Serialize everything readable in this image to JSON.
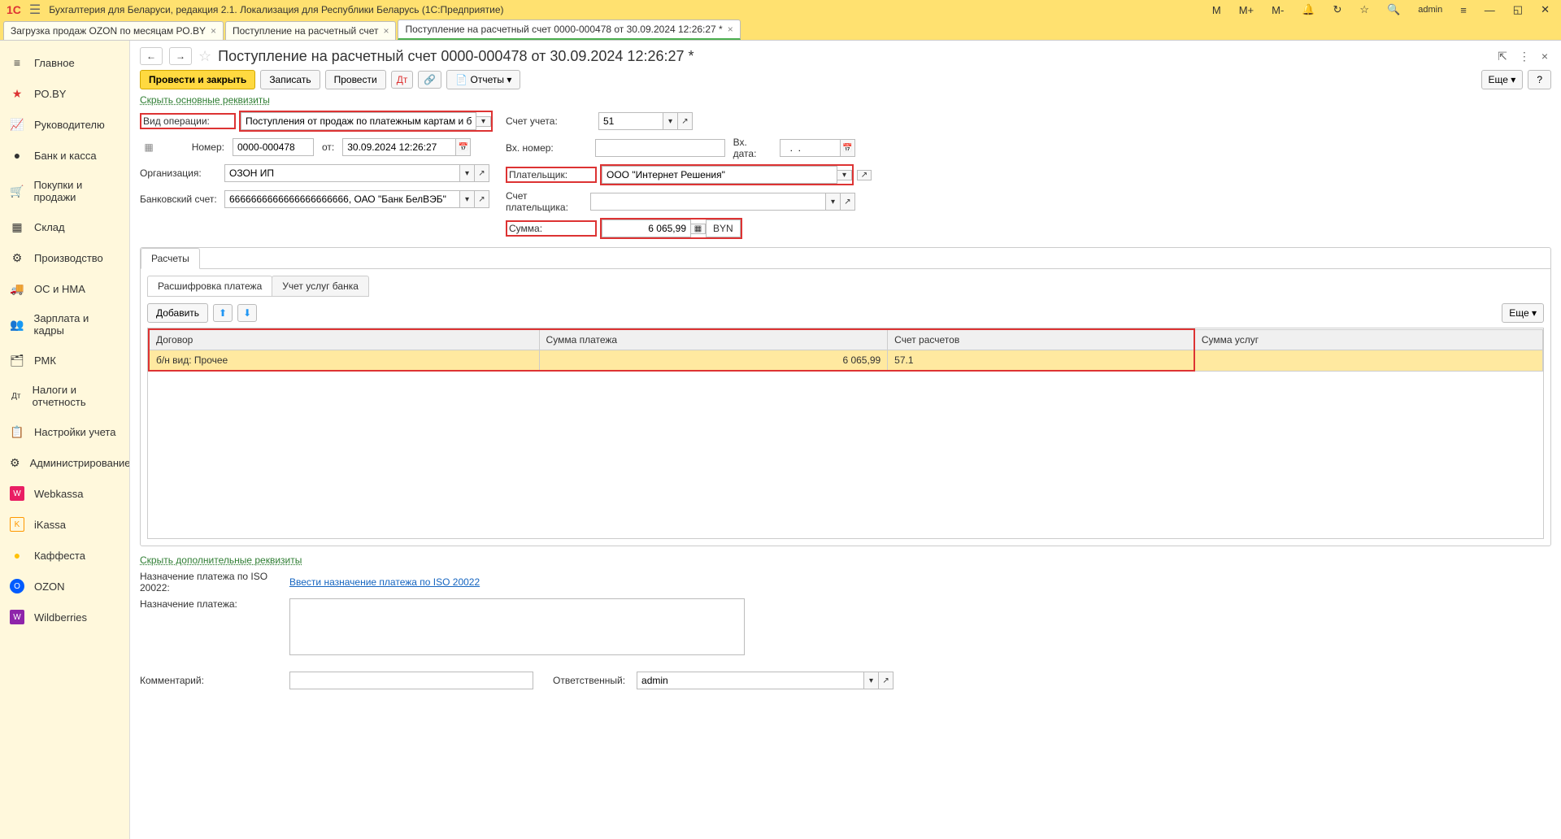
{
  "titlebar": {
    "app_title": "Бухгалтерия для Беларуси, редакция 2.1. Локализация для Республики Беларусь   (1С:Предприятие)",
    "user": "admin",
    "m": "M",
    "m_plus": "M+",
    "m_minus": "M-"
  },
  "doctabs": [
    {
      "label": "Загрузка продаж OZON по месяцам РО.BY",
      "active": false
    },
    {
      "label": "Поступление на расчетный счет",
      "active": false
    },
    {
      "label": "Поступление на расчетный счет 0000-000478 от 30.09.2024 12:26:27 *",
      "active": true
    }
  ],
  "sidebar": [
    {
      "label": "Главное",
      "icon": "≡"
    },
    {
      "label": "РО.BY",
      "icon": "★"
    },
    {
      "label": "Руководителю",
      "icon": "📈"
    },
    {
      "label": "Банк и касса",
      "icon": "💰"
    },
    {
      "label": "Покупки и продажи",
      "icon": "🛒"
    },
    {
      "label": "Склад",
      "icon": "▦"
    },
    {
      "label": "Производство",
      "icon": "🏭"
    },
    {
      "label": "ОС и НМА",
      "icon": "🚚"
    },
    {
      "label": "Зарплата и кадры",
      "icon": "👥"
    },
    {
      "label": "РМК",
      "icon": "🗂"
    },
    {
      "label": "Налоги и отчетность",
      "icon": "Дт"
    },
    {
      "label": "Настройки учета",
      "icon": "📋"
    },
    {
      "label": "Администрирование",
      "icon": "⚙"
    },
    {
      "label": "Webkassa",
      "icon": "W"
    },
    {
      "label": "iKassa",
      "icon": "K"
    },
    {
      "label": "Каффеста",
      "icon": "●"
    },
    {
      "label": "OZON",
      "icon": "O"
    },
    {
      "label": "Wildberries",
      "icon": "W"
    }
  ],
  "doc": {
    "title": "Поступление на расчетный счет 0000-000478 от 30.09.2024 12:26:27 *",
    "toolbar": {
      "post_close": "Провести и закрыть",
      "save": "Записать",
      "post": "Провести",
      "reports": "Отчеты",
      "more": "Еще",
      "help": "?"
    },
    "hide_main": "Скрыть основные реквизиты",
    "hide_extra": "Скрыть дополнительные реквизиты",
    "labels": {
      "op_type": "Вид операции:",
      "number": "Номер:",
      "from": "от:",
      "org": "Организация:",
      "bank_acc": "Банковский счет:",
      "acc": "Счет учета:",
      "ext_number": "Вх. номер:",
      "ext_date": "Вх. дата:",
      "payer": "Плательщик:",
      "payer_acc": "Счет плательщика:",
      "sum": "Сумма:"
    },
    "values": {
      "op_type": "Поступления от продаж по платежным картам и банковским кр",
      "number": "0000-000478",
      "date": "30.09.2024 12:26:27",
      "org": "ОЗОН ИП",
      "bank_acc": "6666666666666666666666, ОАО \"Банк БелВЭБ\"",
      "acc": "51",
      "ext_number": "",
      "ext_date": "  .  .",
      "payer": "ООО \"Интернет Решения\"",
      "payer_acc": "",
      "sum": "6 065,99",
      "currency": "BYN"
    },
    "tabs": {
      "calc": "Расчеты",
      "inner": {
        "decode": "Расшифровка платежа",
        "bank_svc": "Учет услуг банка"
      },
      "add": "Добавить",
      "more": "Еще"
    },
    "table": {
      "col_contract": "Договор",
      "col_sum": "Сумма платежа",
      "col_acc": "Счет расчетов",
      "col_svc": "Сумма услуг",
      "rows": [
        {
          "contract": "б/н вид: Прочее",
          "sum": "6 065,99",
          "acc": "57.1",
          "svc": ""
        }
      ]
    },
    "bottom": {
      "iso_label": "Назначение платежа по ISO 20022:",
      "iso_link": "Ввести назначение платежа по ISO 20022",
      "purpose_label": "Назначение платежа:",
      "comment_label": "Комментарий:",
      "responsible_label": "Ответственный:",
      "responsible_value": "admin"
    }
  }
}
